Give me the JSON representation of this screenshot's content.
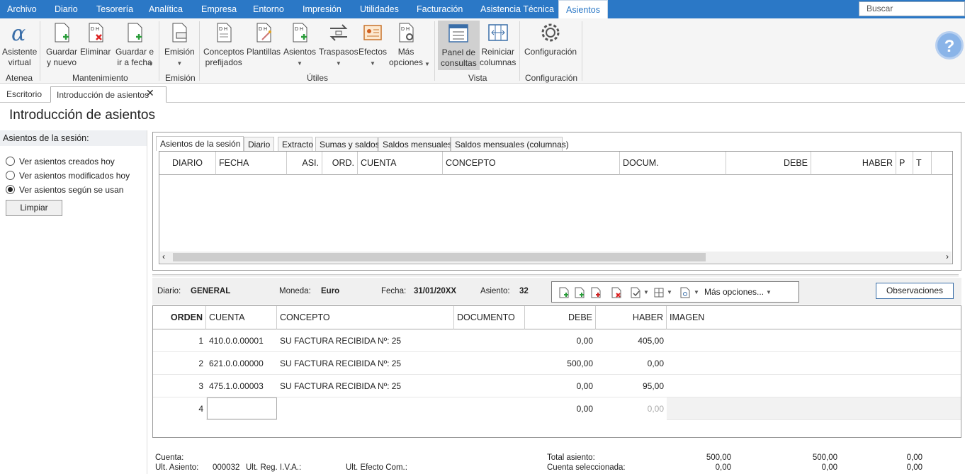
{
  "menu": [
    "Archivo",
    "Diario",
    "Tesorería",
    "Analítica",
    "Empresa",
    "Entorno",
    "Impresión",
    "Utilidades",
    "Facturación",
    "Asistencia Técnica",
    "Asientos"
  ],
  "search_placeholder": "Buscar",
  "ribbon": {
    "asistente": "Asistente\nvirtual",
    "guardar_nuevo": "Guardar\ny nuevo",
    "eliminar": "Eliminar",
    "guardar_fecha": "Guardar e\nir a fecha",
    "emision": "Emisión",
    "conceptos": "Conceptos\nprefijados",
    "plantillas": "Plantillas",
    "asientos": "Asientos",
    "traspasos": "Traspasos",
    "efectos": "Efectos",
    "mas_opciones": "Más\nopciones",
    "panel_consultas": "Panel de\nconsultas",
    "reiniciar": "Reiniciar\ncolumnas",
    "configuracion": "Configuración",
    "groups": [
      "Atenea",
      "Mantenimiento",
      "Emisión",
      "Útiles",
      "Vista",
      "Configuración"
    ]
  },
  "doc_tabs": [
    "Escritorio",
    "Introducción de asientos"
  ],
  "page_title": "Introducción de asientos",
  "left": {
    "title": "Asientos de la sesión:",
    "options": [
      "Ver asientos creados hoy",
      "Ver asientos modificados hoy",
      "Ver asientos según se usan"
    ],
    "selected": 2,
    "clear_label": "Limpiar"
  },
  "inner_tabs": [
    "Asientos de la sesión",
    "Diario",
    "Extracto",
    "Sumas y saldos",
    "Saldos mensuales",
    "Saldos mensuales (columnas)"
  ],
  "grid1_headers": [
    "DIARIO",
    "FECHA",
    "ASI.",
    "ORD.",
    "CUENTA",
    "CONCEPTO",
    "DOCUM.",
    "DEBE",
    "HABER",
    "P",
    "T"
  ],
  "info": {
    "diario_label": "Diario:",
    "diario": "GENERAL",
    "moneda_label": "Moneda:",
    "moneda": "Euro",
    "fecha_label": "Fecha:",
    "fecha": "31/01/20XX",
    "asiento_label": "Asiento:",
    "asiento": "32",
    "mas_opciones": "Más opciones...",
    "observaciones": "Observaciones"
  },
  "grid2_headers": [
    "ORDEN",
    "CUENTA",
    "CONCEPTO",
    "DOCUMENTO",
    "DEBE",
    "HABER",
    "IMAGEN"
  ],
  "rows": [
    {
      "orden": "1",
      "cuenta": "410.0.0.00001",
      "concepto": "SU FACTURA RECIBIDA Nº:  25",
      "documento": "",
      "debe": "0,00",
      "haber": "405,00"
    },
    {
      "orden": "2",
      "cuenta": "621.0.0.00000",
      "concepto": "SU FACTURA RECIBIDA Nº:  25",
      "documento": "",
      "debe": "500,00",
      "haber": "0,00"
    },
    {
      "orden": "3",
      "cuenta": "475.1.0.00003",
      "concepto": "SU FACTURA RECIBIDA Nº:  25",
      "documento": "",
      "debe": "0,00",
      "haber": "95,00"
    },
    {
      "orden": "4",
      "cuenta": "",
      "concepto": "",
      "documento": "",
      "debe": "0,00",
      "haber": "0,00"
    }
  ],
  "footer": {
    "cuenta_label": "Cuenta:",
    "ult_asiento_label": "Ult. Asiento:",
    "ult_asiento": "000032",
    "ult_reg_iva_label": "Ult. Reg. I.V.A.:",
    "ult_efecto_label": "Ult. Efecto Com.:",
    "total_asiento_label": "Total asiento:",
    "cuenta_sel_label": "Cuenta seleccionada:",
    "total": [
      "500,00",
      "500,00",
      "0,00"
    ],
    "sel": [
      "0,00",
      "0,00",
      "0,00"
    ]
  },
  "colors": {
    "menubar": "#2b78c6",
    "ribbon": "#f5f5f5"
  }
}
